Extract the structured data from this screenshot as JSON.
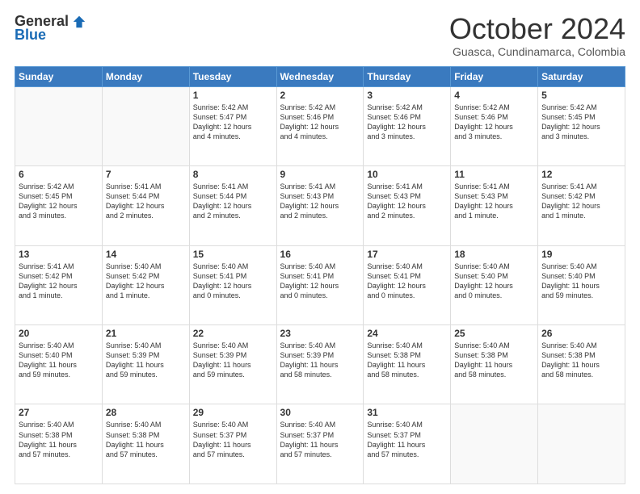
{
  "header": {
    "logo_general": "General",
    "logo_blue": "Blue",
    "month_title": "October 2024",
    "location": "Guasca, Cundinamarca, Colombia"
  },
  "weekdays": [
    "Sunday",
    "Monday",
    "Tuesday",
    "Wednesday",
    "Thursday",
    "Friday",
    "Saturday"
  ],
  "rows": [
    [
      {
        "day": "",
        "text": ""
      },
      {
        "day": "",
        "text": ""
      },
      {
        "day": "1",
        "text": "Sunrise: 5:42 AM\nSunset: 5:47 PM\nDaylight: 12 hours\nand 4 minutes."
      },
      {
        "day": "2",
        "text": "Sunrise: 5:42 AM\nSunset: 5:46 PM\nDaylight: 12 hours\nand 4 minutes."
      },
      {
        "day": "3",
        "text": "Sunrise: 5:42 AM\nSunset: 5:46 PM\nDaylight: 12 hours\nand 3 minutes."
      },
      {
        "day": "4",
        "text": "Sunrise: 5:42 AM\nSunset: 5:46 PM\nDaylight: 12 hours\nand 3 minutes."
      },
      {
        "day": "5",
        "text": "Sunrise: 5:42 AM\nSunset: 5:45 PM\nDaylight: 12 hours\nand 3 minutes."
      }
    ],
    [
      {
        "day": "6",
        "text": "Sunrise: 5:42 AM\nSunset: 5:45 PM\nDaylight: 12 hours\nand 3 minutes."
      },
      {
        "day": "7",
        "text": "Sunrise: 5:41 AM\nSunset: 5:44 PM\nDaylight: 12 hours\nand 2 minutes."
      },
      {
        "day": "8",
        "text": "Sunrise: 5:41 AM\nSunset: 5:44 PM\nDaylight: 12 hours\nand 2 minutes."
      },
      {
        "day": "9",
        "text": "Sunrise: 5:41 AM\nSunset: 5:43 PM\nDaylight: 12 hours\nand 2 minutes."
      },
      {
        "day": "10",
        "text": "Sunrise: 5:41 AM\nSunset: 5:43 PM\nDaylight: 12 hours\nand 2 minutes."
      },
      {
        "day": "11",
        "text": "Sunrise: 5:41 AM\nSunset: 5:43 PM\nDaylight: 12 hours\nand 1 minute."
      },
      {
        "day": "12",
        "text": "Sunrise: 5:41 AM\nSunset: 5:42 PM\nDaylight: 12 hours\nand 1 minute."
      }
    ],
    [
      {
        "day": "13",
        "text": "Sunrise: 5:41 AM\nSunset: 5:42 PM\nDaylight: 12 hours\nand 1 minute."
      },
      {
        "day": "14",
        "text": "Sunrise: 5:40 AM\nSunset: 5:42 PM\nDaylight: 12 hours\nand 1 minute."
      },
      {
        "day": "15",
        "text": "Sunrise: 5:40 AM\nSunset: 5:41 PM\nDaylight: 12 hours\nand 0 minutes."
      },
      {
        "day": "16",
        "text": "Sunrise: 5:40 AM\nSunset: 5:41 PM\nDaylight: 12 hours\nand 0 minutes."
      },
      {
        "day": "17",
        "text": "Sunrise: 5:40 AM\nSunset: 5:41 PM\nDaylight: 12 hours\nand 0 minutes."
      },
      {
        "day": "18",
        "text": "Sunrise: 5:40 AM\nSunset: 5:40 PM\nDaylight: 12 hours\nand 0 minutes."
      },
      {
        "day": "19",
        "text": "Sunrise: 5:40 AM\nSunset: 5:40 PM\nDaylight: 11 hours\nand 59 minutes."
      }
    ],
    [
      {
        "day": "20",
        "text": "Sunrise: 5:40 AM\nSunset: 5:40 PM\nDaylight: 11 hours\nand 59 minutes."
      },
      {
        "day": "21",
        "text": "Sunrise: 5:40 AM\nSunset: 5:39 PM\nDaylight: 11 hours\nand 59 minutes."
      },
      {
        "day": "22",
        "text": "Sunrise: 5:40 AM\nSunset: 5:39 PM\nDaylight: 11 hours\nand 59 minutes."
      },
      {
        "day": "23",
        "text": "Sunrise: 5:40 AM\nSunset: 5:39 PM\nDaylight: 11 hours\nand 58 minutes."
      },
      {
        "day": "24",
        "text": "Sunrise: 5:40 AM\nSunset: 5:38 PM\nDaylight: 11 hours\nand 58 minutes."
      },
      {
        "day": "25",
        "text": "Sunrise: 5:40 AM\nSunset: 5:38 PM\nDaylight: 11 hours\nand 58 minutes."
      },
      {
        "day": "26",
        "text": "Sunrise: 5:40 AM\nSunset: 5:38 PM\nDaylight: 11 hours\nand 58 minutes."
      }
    ],
    [
      {
        "day": "27",
        "text": "Sunrise: 5:40 AM\nSunset: 5:38 PM\nDaylight: 11 hours\nand 57 minutes."
      },
      {
        "day": "28",
        "text": "Sunrise: 5:40 AM\nSunset: 5:38 PM\nDaylight: 11 hours\nand 57 minutes."
      },
      {
        "day": "29",
        "text": "Sunrise: 5:40 AM\nSunset: 5:37 PM\nDaylight: 11 hours\nand 57 minutes."
      },
      {
        "day": "30",
        "text": "Sunrise: 5:40 AM\nSunset: 5:37 PM\nDaylight: 11 hours\nand 57 minutes."
      },
      {
        "day": "31",
        "text": "Sunrise: 5:40 AM\nSunset: 5:37 PM\nDaylight: 11 hours\nand 57 minutes."
      },
      {
        "day": "",
        "text": ""
      },
      {
        "day": "",
        "text": ""
      }
    ]
  ]
}
